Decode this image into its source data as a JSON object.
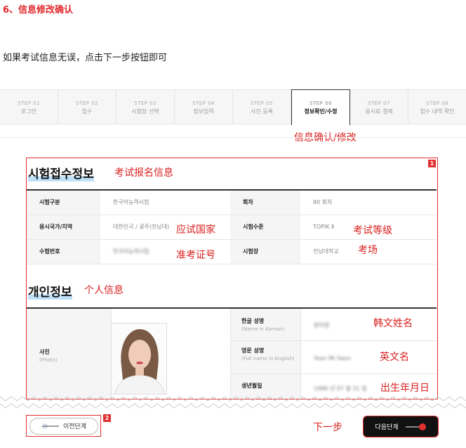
{
  "heading": "6、信息修改确认",
  "instruction": "如果考试信息无误，点击下一步按钮即可",
  "steps": [
    {
      "num": "STEP 01",
      "label": "로그인"
    },
    {
      "num": "STEP 02",
      "label": "접수"
    },
    {
      "num": "STEP 03",
      "label": "시험장 선택"
    },
    {
      "num": "STEP 04",
      "label": "정보입력"
    },
    {
      "num": "STEP 05",
      "label": "사진 등록"
    },
    {
      "num": "STEP 06",
      "label": "정보확인/수정",
      "active": true
    },
    {
      "num": "STEP 07",
      "label": "응시료 결제"
    },
    {
      "num": "STEP 08",
      "label": "접수 내역 확인"
    }
  ],
  "steps_caption": "信息确认/修改",
  "exam_section": {
    "title": "시험접수정보",
    "annotation": "考试报名信息",
    "tag": "1",
    "rows": [
      {
        "label1": "시험구분",
        "value1": "한국어능력시험",
        "label2": "회차",
        "value2": "80 회차"
      },
      {
        "label1": "응시국가/지역",
        "value1": "대한민국 / 광주(전남대)",
        "label2": "시험수준",
        "value2": "TOPIK Ⅱ"
      },
      {
        "label1": "수험번호",
        "value1": "한국어능력시험",
        "label2": "시험장",
        "value2": "전남대학교"
      }
    ],
    "annotations": {
      "country": "应试国家",
      "level": "考试等级",
      "number": "准考证号",
      "venue": "考场"
    }
  },
  "personal_section": {
    "title": "개인정보",
    "annotation": "个人信息",
    "photo_label": "사진",
    "photo_sub": "(Photo)",
    "fields": [
      {
        "label": "한글 성명",
        "sub": "(Name in Korean)",
        "value": "윤미영",
        "annotation": "韩文姓名"
      },
      {
        "label": "영문 성명",
        "sub": "(Full name in English)",
        "value": "Yoon Mi Seon",
        "annotation": "英文名"
      },
      {
        "label": "생년월일",
        "sub": "",
        "value": "1996 년 07 월 31 일",
        "annotation": "出生年月日"
      }
    ]
  },
  "buttons": {
    "prev_label": "이전단계",
    "prev_tag": "2",
    "next_label": "다음단계",
    "next_annotation": "下一步"
  },
  "colors": {
    "accent_red": "#e23030",
    "annotation_red": "#d9211f",
    "next_button_bg": "#111111",
    "highlight_blue": "#bfe0f7"
  }
}
